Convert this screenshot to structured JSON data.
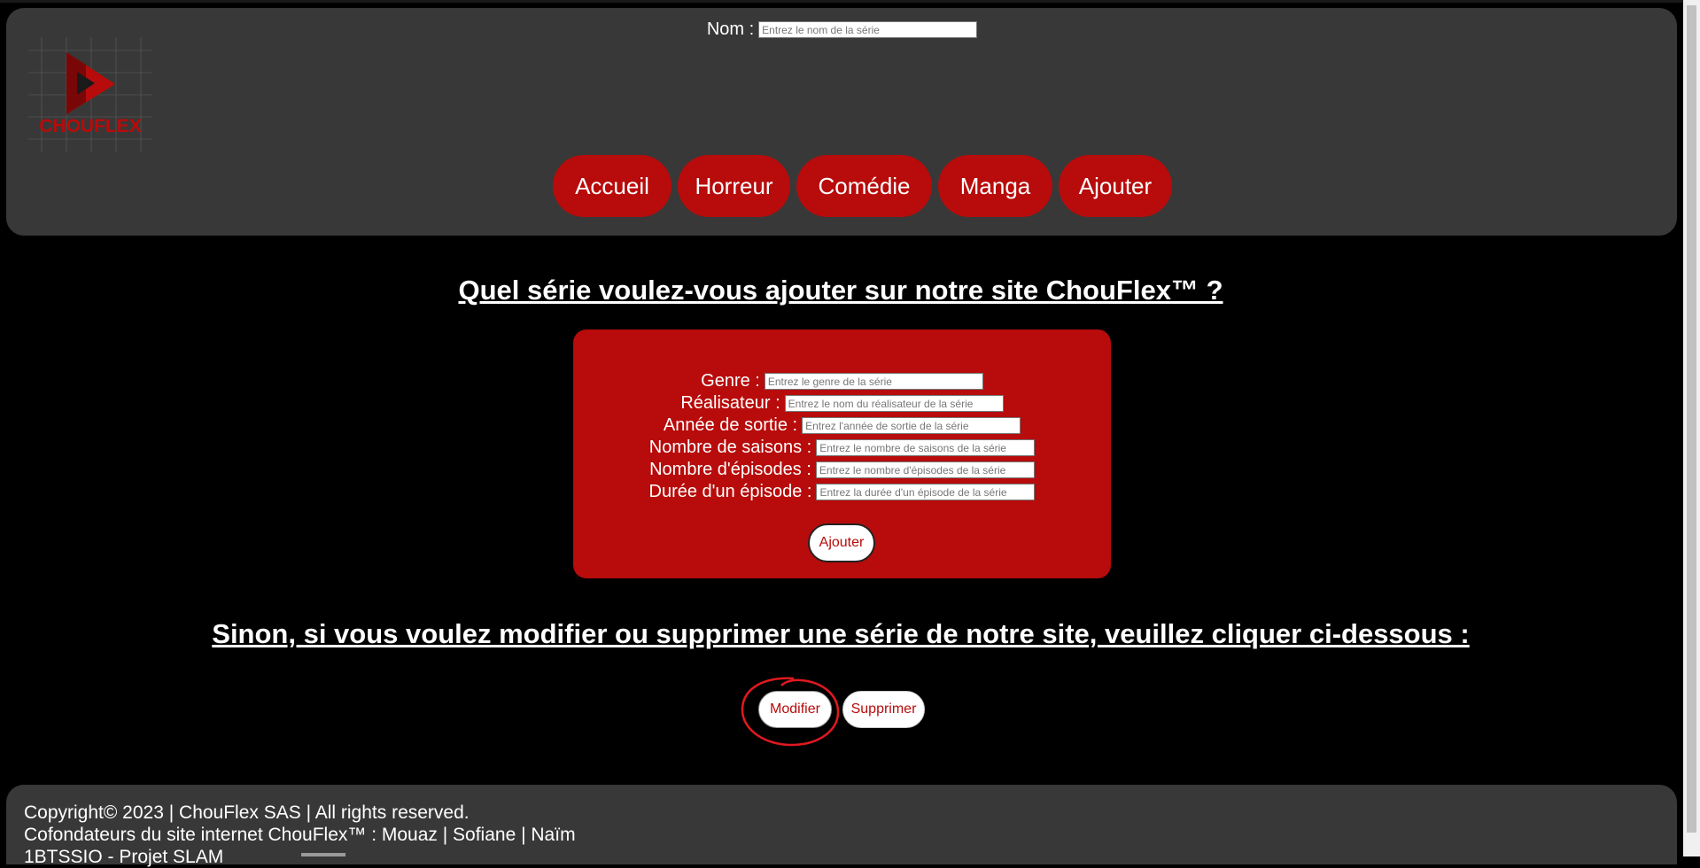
{
  "colors": {
    "accent": "#b80b0b",
    "panel": "#383838",
    "background": "#000000"
  },
  "header": {
    "logo_text": "CHOUFLEX",
    "nav": [
      {
        "label": "Accueil"
      },
      {
        "label": "Horreur"
      },
      {
        "label": "Comédie"
      },
      {
        "label": "Manga"
      },
      {
        "label": "Ajouter"
      }
    ]
  },
  "main": {
    "title": "Quel série voulez-vous ajouter sur notre site ChouFlex™ ?",
    "form": {
      "fields": [
        {
          "label": "Nom :",
          "placeholder": "Entrez le nom de la série",
          "value": ""
        },
        {
          "label": "Genre :",
          "placeholder": "Entrez le genre de la série",
          "value": ""
        },
        {
          "label": "Réalisateur :",
          "placeholder": "Entrez le nom du réalisateur de la série",
          "value": ""
        },
        {
          "label": "Année de sortie :",
          "placeholder": "Entrez l'année de sortie de la série",
          "value": ""
        },
        {
          "label": "Nombre de saisons :",
          "placeholder": "Entrez le nombre de saisons de la série",
          "value": ""
        },
        {
          "label": "Nombre d'épisodes :",
          "placeholder": "Entrez le nombre d'épisodes de la série",
          "value": ""
        },
        {
          "label": "Durée d'un épisode :",
          "placeholder": "Entrez la durée d'un épisode de la série",
          "value": ""
        }
      ],
      "submit_label": "Ajouter"
    },
    "subtitle": "Sinon, si vous voulez modifier ou supprimer une série de notre site, veuillez cliquer ci-dessous :",
    "modify_label": "Modifier",
    "delete_label": "Supprimer"
  },
  "footer": {
    "copyright": "Copyright© 2023 | ChouFlex SAS | All rights reserved.",
    "founders": "Cofondateurs du site internet ChouFlex™ : Mouaz | Sofiane | Naïm",
    "project": "1BTSSIO - Projet SLAM"
  }
}
